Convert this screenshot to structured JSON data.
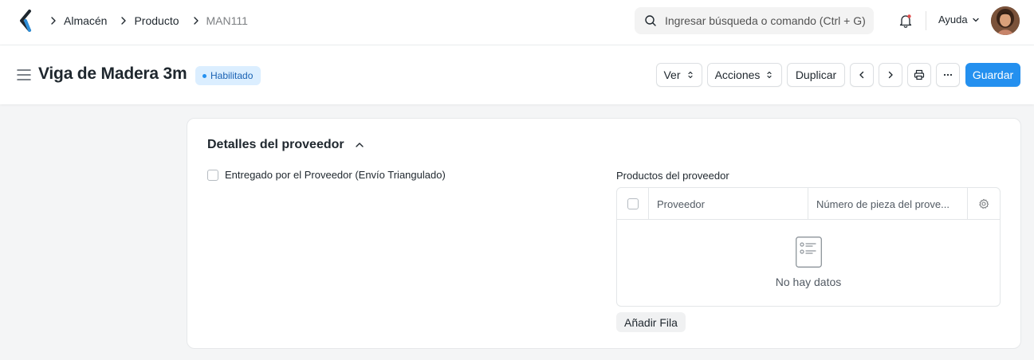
{
  "navbar": {
    "breadcrumbs": [
      "Almacén",
      "Producto",
      "MAN111"
    ],
    "search_placeholder": "Ingresar búsqueda o comando (Ctrl + G)",
    "help_label": "Ayuda"
  },
  "page": {
    "title": "Viga de Madera 3m",
    "status": "Habilitado",
    "buttons": {
      "view": "Ver",
      "actions": "Acciones",
      "duplicate": "Duplicar",
      "save": "Guardar"
    }
  },
  "section": {
    "title": "Detalles del proveedor",
    "checkbox_label": "Entregado por el Proveedor (Envío Triangulado)",
    "checkbox_checked": false,
    "table": {
      "label": "Productos del proveedor",
      "columns": [
        "Proveedor",
        "Número de pieza del prove..."
      ],
      "empty_text": "No hay datos",
      "add_row_label": "Añadir Fila"
    }
  },
  "colors": {
    "primary": "#2490ef",
    "badge_bg": "#dbeeff",
    "badge_text": "#1861b3"
  }
}
